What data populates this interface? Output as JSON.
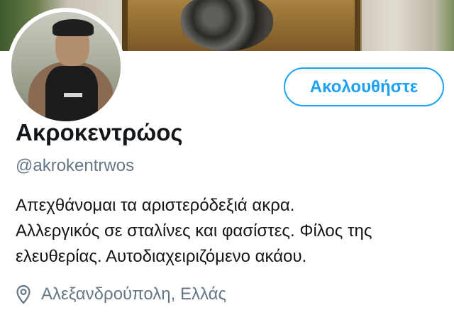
{
  "profile": {
    "display_name": "Ακροκεντρώος",
    "handle": "@akrokentrwos",
    "bio_lines": [
      "Απεχθάνομαι τα αριστερόδεξιά ακρα.",
      "Αλλεργικός σε σταλίνες και φασίστες. Φίλος της",
      "ελευθερίας. Αυτοδιαχειριζόμενο ακάου."
    ],
    "location": "Αλεξανδρούπολη, Ελλάς"
  },
  "actions": {
    "follow_label": "Ακολουθήστε"
  },
  "icons": {
    "location": "location-pin-icon"
  },
  "colors": {
    "accent": "#1da1f2",
    "secondary_text": "#657786",
    "primary_text": "#14171a"
  }
}
